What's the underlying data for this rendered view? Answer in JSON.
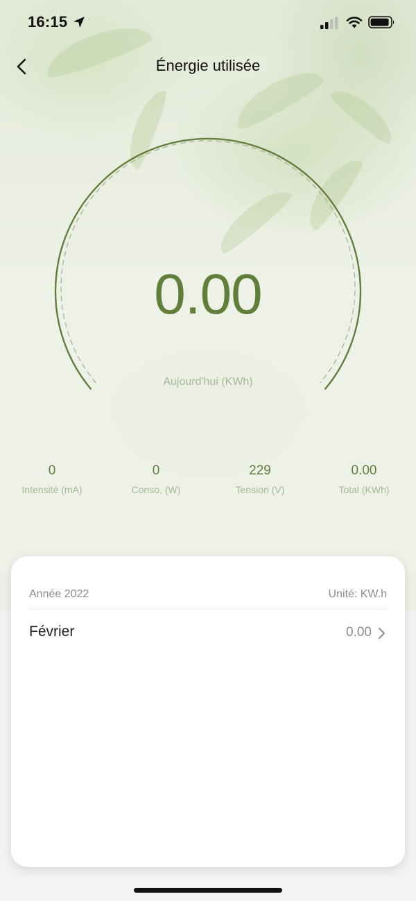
{
  "status_bar": {
    "time": "16:15"
  },
  "header": {
    "title": "Énergie utilisée"
  },
  "gauge": {
    "value": "0.00",
    "caption": "Aujourd'hui (KWh)",
    "accent_color": "#5f7f3a"
  },
  "stats": [
    {
      "value": "0",
      "label": "Intensité (mA)"
    },
    {
      "value": "0",
      "label": "Conso. (W)"
    },
    {
      "value": "229",
      "label": "Tension (V)"
    },
    {
      "value": "0.00",
      "label": "Total (KWh)"
    }
  ],
  "history": {
    "year_label": "Année 2022",
    "unit_label": "Unité: KW.h",
    "months": [
      {
        "name": "Février",
        "value": "0.00"
      }
    ]
  },
  "icons": {
    "back": "chevron-left-icon",
    "location": "location-arrow-icon",
    "signal": "cellular-signal-icon",
    "wifi": "wifi-icon",
    "battery": "battery-icon",
    "row_arrow": "chevron-right-icon"
  }
}
